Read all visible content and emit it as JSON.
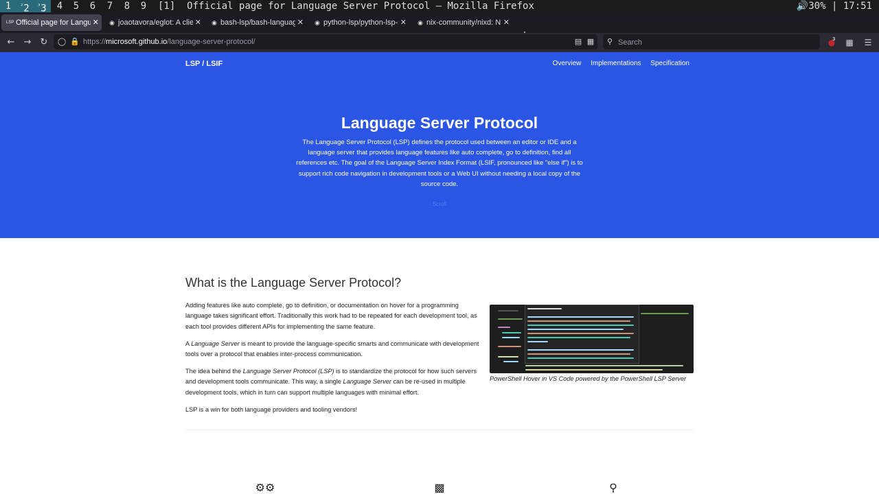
{
  "wm": {
    "workspaces": [
      "1",
      "2",
      "3",
      "4",
      "5",
      "6",
      "7",
      "8",
      "9"
    ],
    "workspace_marks": [
      "",
      "²",
      "³"
    ],
    "active": [
      0,
      1,
      2
    ],
    "layout": "[1]",
    "window_title": "Official page for Language Server Protocol — Mozilla Firefox",
    "volume": "30%",
    "separator": "|",
    "clock": "17:51"
  },
  "tabs": [
    {
      "label": "Official page for Language Server Protocol",
      "icon": "lsp-icon",
      "active": true
    },
    {
      "label": "joaotavora/eglot: A client for Language Server Protocol servers",
      "icon": "github-icon",
      "active": false
    },
    {
      "label": "bash-lsp/bash-language-server",
      "icon": "github-icon",
      "active": false
    },
    {
      "label": "python-lsp/python-lsp-server",
      "icon": "github-icon",
      "active": false
    },
    {
      "label": "nix-community/nixd: Nix language server",
      "icon": "github-icon",
      "active": false
    }
  ],
  "urlbar": {
    "prefix": "https://",
    "host": "microsoft.github.io",
    "path": "/language-server-protocol/"
  },
  "search": {
    "placeholder": "Search"
  },
  "toolbar": {
    "badge_count": "3"
  },
  "page": {
    "brand": "LSP / LSIF",
    "nav": [
      "Overview",
      "Implementations",
      "Specification"
    ],
    "hero_title": "Language Server Protocol",
    "hero_lead": "The Language Server Protocol (LSP) defines the protocol used between an editor or IDE and a language server that provides language features like auto complete, go to definition, find all references etc. The goal of the Language Server Index Format (LSIF, pronounced like \"else if\") is to support rich code navigation in development tools or a Web UI without needing a local copy of the source code.",
    "hero_faint": "Scroll",
    "section_title": "What is the Language Server Protocol?",
    "p1": "Adding features like auto complete, go to definition, or documentation on hover for a programming language takes significant effort. Traditionally this work had to be repeated for each development tool, as each tool provides different APIs for implementing the same feature.",
    "p2_a": "A ",
    "p2_em": "Language Server",
    "p2_b": " is meant to provide the language-specific smarts and communicate with development tools over a protocol that enables inter-process communication.",
    "p3_a": "The idea behind the ",
    "p3_em1": "Language Server Protocol (LSP)",
    "p3_b": " is to standardize the protocol for how such servers and development tools communicate. This way, a single ",
    "p3_em2": "Language Server",
    "p3_c": " can be re-used in multiple development tools, which in turn can support multiple languages with minimal effort.",
    "p4": "LSP is a win for both language providers and tooling vendors!",
    "screenshot_caption": "PowerShell Hover in VS Code powered by the PowerShell LSP Server"
  }
}
